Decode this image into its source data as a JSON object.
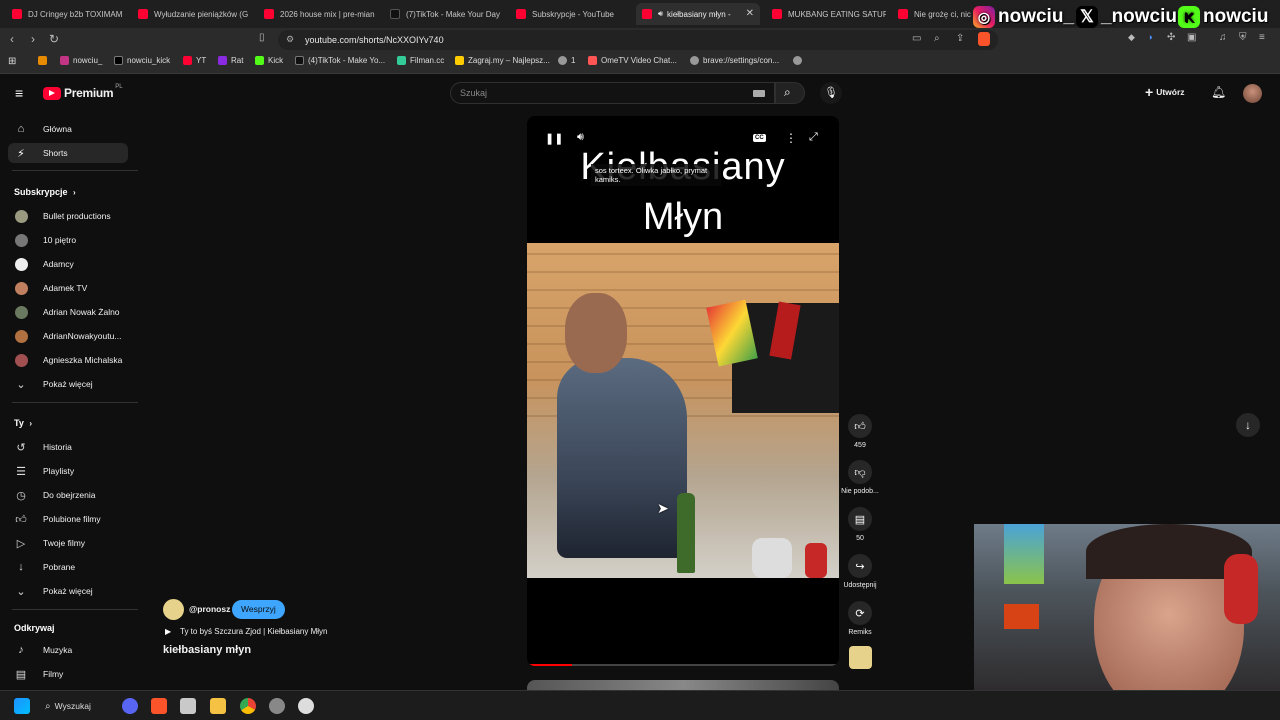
{
  "browser": {
    "tabs": [
      {
        "title": "DJ Cringey b2b TOXIMAM"
      },
      {
        "title": "Wyłudzanie pieniążków (G"
      },
      {
        "title": "2026 house mix | pre-mian"
      },
      {
        "title": "(7)TikTok - Make Your Day"
      },
      {
        "title": "Subskrypcje - YouTube"
      },
      {
        "title": "kiełbasiany młyn -"
      },
      {
        "title": "MUKBANG EATING SATUR"
      },
      {
        "title": "Nie grożę ci, nic"
      }
    ],
    "url": "youtube.com/shorts/NcXXOIYv740",
    "bookmarks": [
      "nowciu_",
      "nowciu_kick",
      "YT",
      "Rat",
      "Kick",
      "(4)TikTok - Make Yo...",
      "Filman.cc",
      "Zagraj.my – Najlepsz...",
      "1",
      "OmeTV Video Chat...",
      "brave://settings/con..."
    ]
  },
  "overlay": {
    "instagram": "nowciu_",
    "x": "_nowciu",
    "kick": "nowciu"
  },
  "youtube": {
    "logo": "Premium",
    "logo_sup": "PL",
    "search_placeholder": "Szukaj",
    "create_label": "Utwórz",
    "sidebar": {
      "main": [
        {
          "label": "Główna",
          "icon": "home-icon"
        },
        {
          "label": "Shorts",
          "icon": "shorts-icon"
        }
      ],
      "subs_header": "Subskrypcje",
      "subs": [
        "Bullet productions",
        "10 piętro",
        "Adamcy",
        "Adamek TV",
        "Adrian Nowak Żalno",
        "AdrianNowakyoutu...",
        "Agnieszka Michalska"
      ],
      "show_more": "Pokaż więcej",
      "you_header": "Ty",
      "you": [
        {
          "label": "Historia",
          "icon": "history-icon"
        },
        {
          "label": "Playlisty",
          "icon": "playlist-icon"
        },
        {
          "label": "Do obejrzenia",
          "icon": "watch-later-icon"
        },
        {
          "label": "Polubione filmy",
          "icon": "like-icon"
        },
        {
          "label": "Twoje filmy",
          "icon": "your-videos-icon"
        },
        {
          "label": "Pobrane",
          "icon": "download-icon"
        },
        {
          "label": "Pokaż więcej",
          "icon": "chevron-down-icon"
        }
      ],
      "explore_header": "Odkrywaj",
      "explore": [
        {
          "label": "Muzyka",
          "icon": "music-icon"
        },
        {
          "label": "Filmy",
          "icon": "film-icon"
        }
      ]
    },
    "short": {
      "overlay_title_1": "Kiełbasiany",
      "overlay_title_2": "Młyn",
      "caption": "sos torteex. Oliwka jabłko, prymat kamiks.",
      "channel": "@pronosz",
      "support_label": "Wesprzyj",
      "audio": "Ty to byś Szczura Zjod | Kiełbasiany Młyn",
      "title": "kiełbasiany młyn",
      "likes": "459",
      "dislike_label": "Nie podob...",
      "comments": "50",
      "share_label": "Udostępnij",
      "remix_label": "Remiks"
    }
  },
  "taskbar": {
    "search_label": "Wyszukaj"
  }
}
